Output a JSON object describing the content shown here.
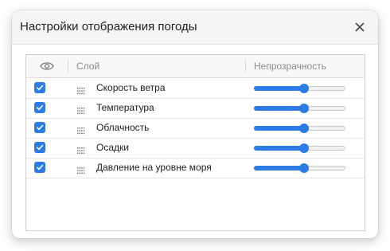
{
  "dialog": {
    "title": "Настройки отображения погоды",
    "close_icon": "close-icon"
  },
  "table": {
    "columns": {
      "visibility_icon": "eye-icon",
      "layer": "Слой",
      "opacity": "Непрозрачность"
    },
    "rows": [
      {
        "name": "Скорость ветра",
        "visible": true,
        "opacity": 0.55
      },
      {
        "name": "Температура",
        "visible": true,
        "opacity": 0.55
      },
      {
        "name": "Облачность",
        "visible": true,
        "opacity": 0.55
      },
      {
        "name": "Осадки",
        "visible": true,
        "opacity": 0.55
      },
      {
        "name": "Давление на уровне моря",
        "visible": true,
        "opacity": 0.55
      }
    ]
  },
  "colors": {
    "accent": "#2d7be5"
  }
}
